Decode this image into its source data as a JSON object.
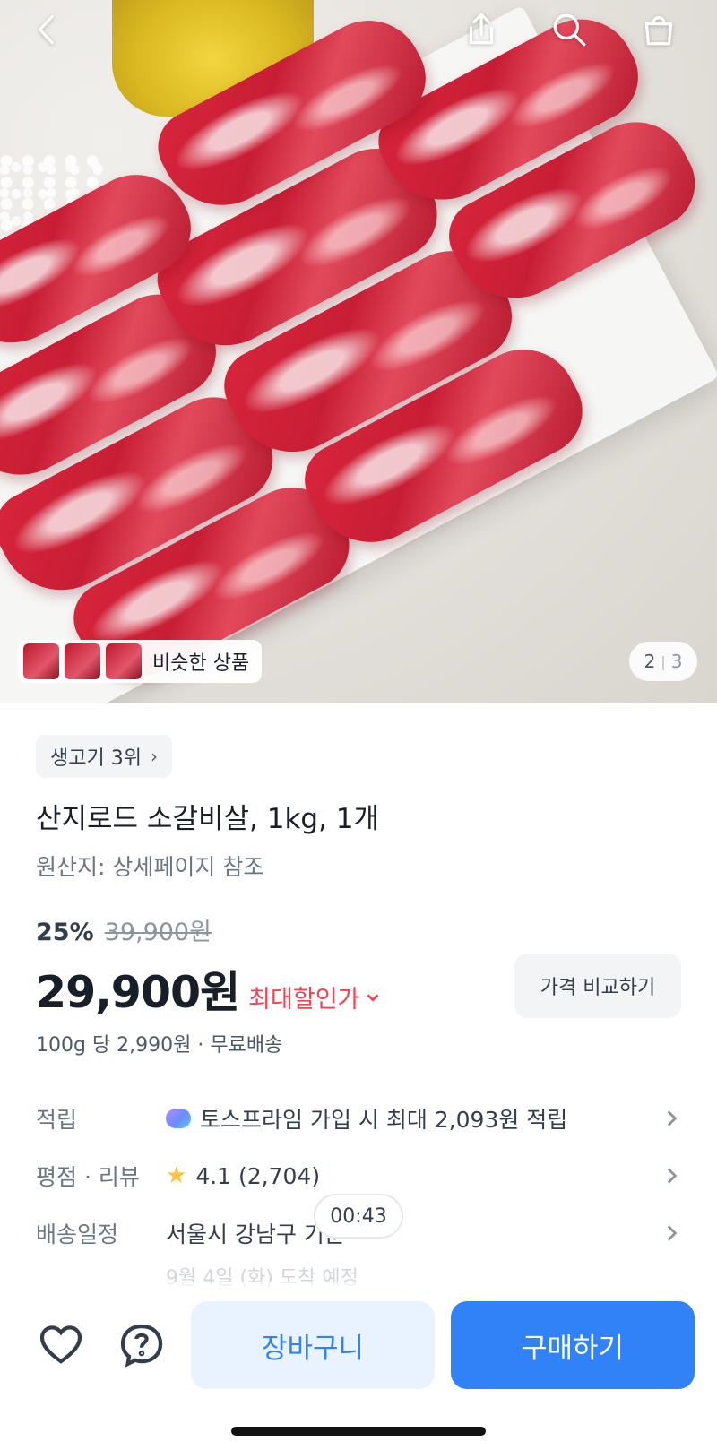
{
  "hero": {
    "pager_current": "2",
    "pager_total": "3",
    "similar_label": "비슷한 상품"
  },
  "product": {
    "rank_badge": "생고기 3위",
    "title": "산지로드 소갈비살, 1kg, 1개",
    "origin": "원산지: 상세페이지 참조",
    "discount": "25%",
    "original_price": "39,900원",
    "price": "29,900원",
    "lowest_label": "최대할인가",
    "compare_button": "가격 비교하기",
    "unit_line": "100g 당 2,990원 · 무료배송"
  },
  "info": {
    "points_label": "적립",
    "points_value": "토스프라임 가입 시 최대 2,093원 적립",
    "rating_label": "평점 · 리뷰",
    "rating_value": "4.1 (2,704)",
    "delivery_label": "배송일정",
    "delivery_value": "서울시 강남구 기준",
    "delivery_eta": "9월 4일 (화) 도착 예정"
  },
  "timer": "00:43",
  "bottom": {
    "cart_label": "장바구니",
    "buy_label": "구매하기"
  },
  "colors": {
    "accent": "#3182f6",
    "accent_light": "#e8f3ff",
    "sale": "#f04452",
    "star": "#ffc342"
  }
}
